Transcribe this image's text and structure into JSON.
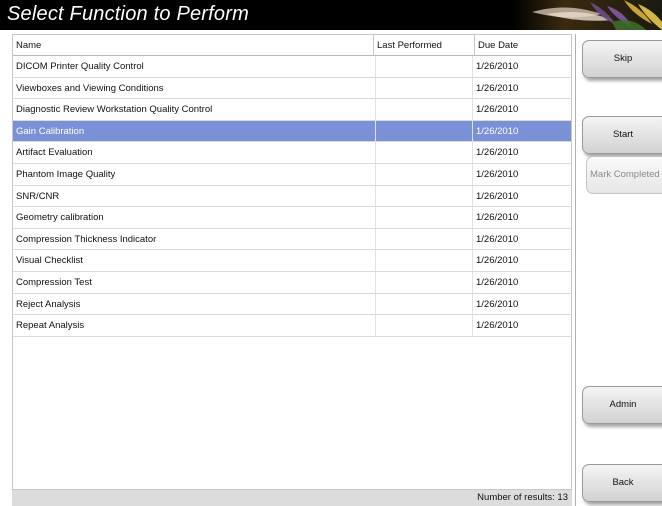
{
  "window": {
    "title": "Select Function to Perform"
  },
  "table": {
    "columns": [
      "Name",
      "Last Performed",
      "Due Date"
    ],
    "rows": [
      {
        "name": "DICOM Printer Quality Control",
        "last_performed": "",
        "due_date": "1/26/2010",
        "selected": false
      },
      {
        "name": "Viewboxes and Viewing Conditions",
        "last_performed": "",
        "due_date": "1/26/2010",
        "selected": false
      },
      {
        "name": "Diagnostic Review Workstation Quality Control",
        "last_performed": "",
        "due_date": "1/26/2010",
        "selected": false
      },
      {
        "name": "Gain Calibration",
        "last_performed": "",
        "due_date": "1/26/2010",
        "selected": true
      },
      {
        "name": "Artifact Evaluation",
        "last_performed": "",
        "due_date": "1/26/2010",
        "selected": false
      },
      {
        "name": "Phantom Image Quality",
        "last_performed": "",
        "due_date": "1/26/2010",
        "selected": false
      },
      {
        "name": "SNR/CNR",
        "last_performed": "",
        "due_date": "1/26/2010",
        "selected": false
      },
      {
        "name": "Geometry calibration",
        "last_performed": "",
        "due_date": "1/26/2010",
        "selected": false
      },
      {
        "name": "Compression Thickness Indicator",
        "last_performed": "",
        "due_date": "1/26/2010",
        "selected": false
      },
      {
        "name": "Visual Checklist",
        "last_performed": "",
        "due_date": "1/26/2010",
        "selected": false
      },
      {
        "name": "Compression Test",
        "last_performed": "",
        "due_date": "1/26/2010",
        "selected": false
      },
      {
        "name": "Reject Analysis",
        "last_performed": "",
        "due_date": "1/26/2010",
        "selected": false
      },
      {
        "name": "Repeat Analysis",
        "last_performed": "",
        "due_date": "1/26/2010",
        "selected": false
      }
    ]
  },
  "status": {
    "results_label": "Number of results: 13"
  },
  "buttons": {
    "skip": "Skip",
    "start": "Start",
    "mark_completed": "Mark Completed",
    "admin": "Admin",
    "back": "Back"
  },
  "colors": {
    "selection": "#7a91d8",
    "titlebar": "#000000",
    "status_bar": "#dcdcdc"
  }
}
